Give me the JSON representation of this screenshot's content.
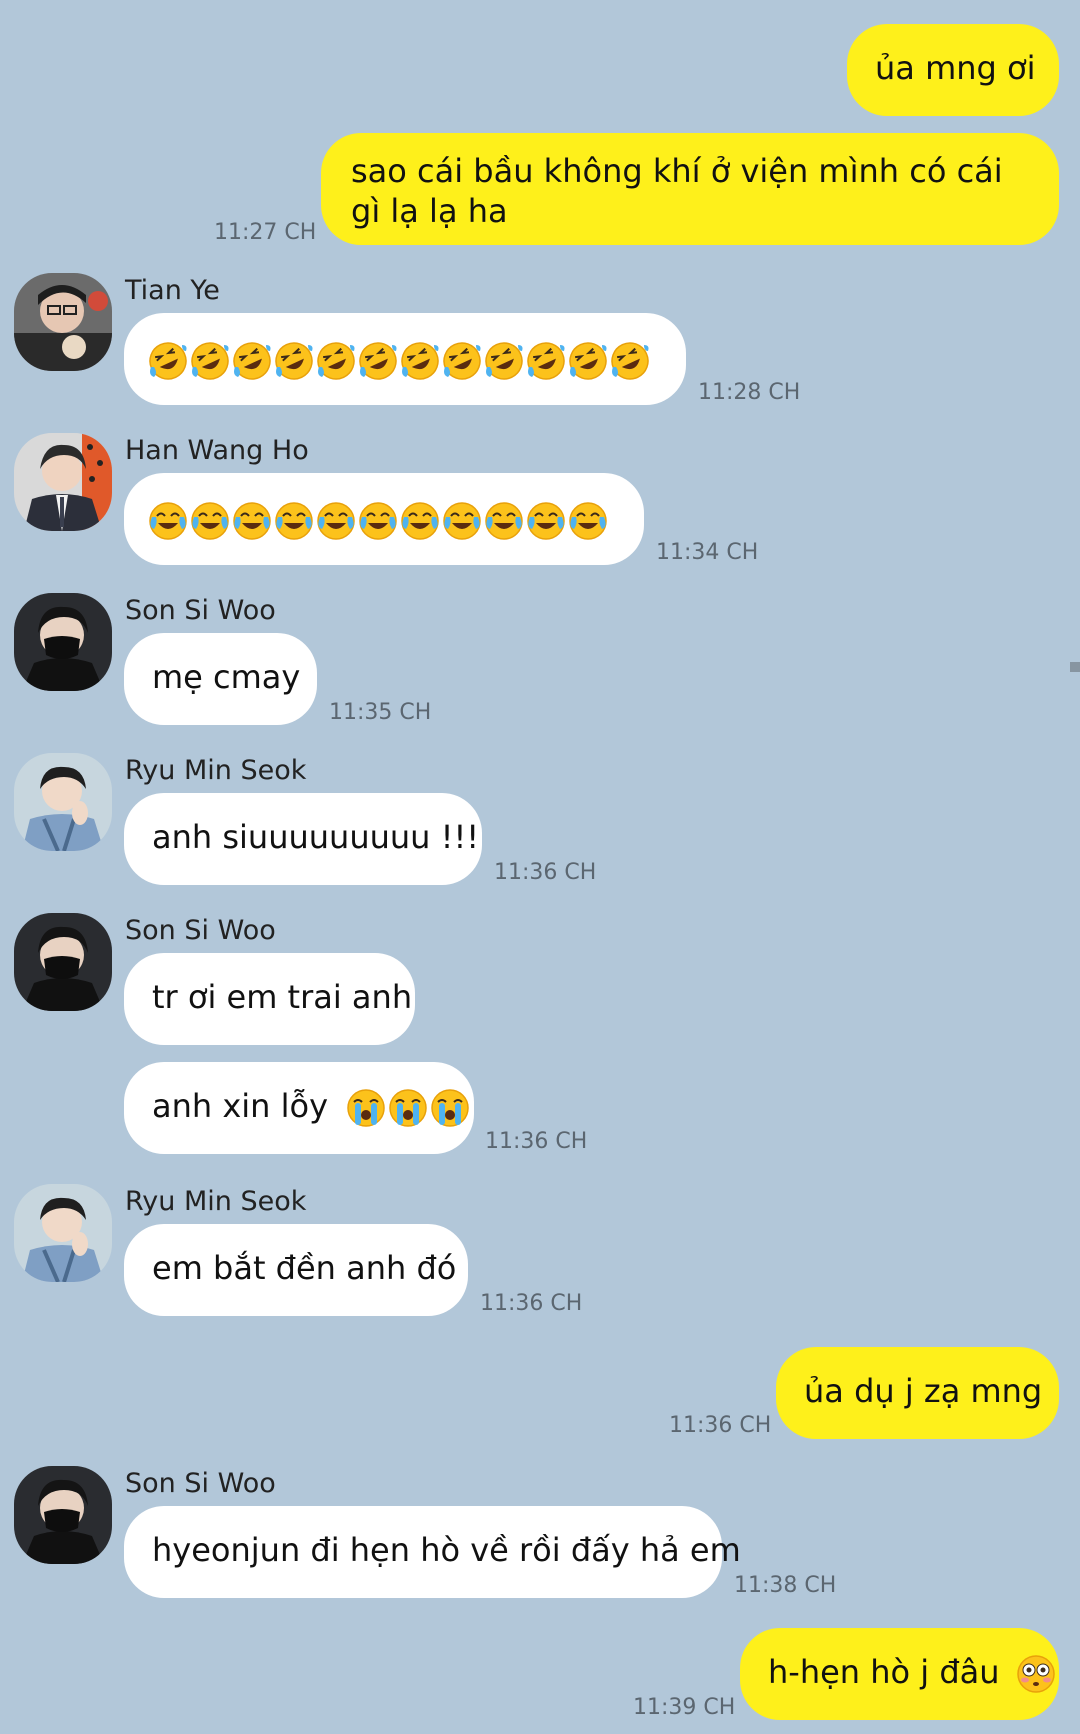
{
  "colors": {
    "background": "#b2c7d9",
    "my_bubble": "#fef01b",
    "their_bubble": "#ffffff",
    "time_text": "#5b6670"
  },
  "messages": [
    {
      "sender": "me",
      "text": "ủa mng ơi"
    },
    {
      "sender": "me",
      "text": "sao cái bầu không khí ở viện mình có cái gì lạ lạ ha",
      "time": "11:27 CH"
    },
    {
      "sender": "Tian Ye",
      "name": "Tian Ye",
      "emoji": "rofl",
      "count": 12,
      "time": "11:28 CH"
    },
    {
      "sender": "Han Wang Ho",
      "name": "Han Wang Ho",
      "emoji": "joy",
      "count": 11,
      "time": "11:34 CH"
    },
    {
      "sender": "Son Si Woo",
      "name": "Son Si Woo",
      "text": "mẹ cmay",
      "time": "11:35 CH"
    },
    {
      "sender": "Ryu Min Seok",
      "name": "Ryu Min Seok",
      "text": "anh siuuuuuuuuu !!!",
      "time": "11:36 CH"
    },
    {
      "sender": "Son Si Woo",
      "name": "Son Si Woo",
      "text": "tr ơi em trai anh"
    },
    {
      "sender": "Son Si Woo",
      "text": "anh xin lỗy",
      "trailing_emoji": "sob",
      "trailing_count": 3,
      "time": "11:36 CH"
    },
    {
      "sender": "Ryu Min Seok",
      "name": "Ryu Min Seok",
      "text": "em bắt đền anh đó",
      "time": "11:36 CH"
    },
    {
      "sender": "me",
      "text": "ủa dụ j zạ mng",
      "time": "11:36 CH"
    },
    {
      "sender": "Son Si Woo",
      "name": "Son Si Woo",
      "text": "hyeonjun đi hẹn hò về rồi đấy hả em",
      "time": "11:38 CH"
    },
    {
      "sender": "me",
      "text": "h-hẹn hò j đâu",
      "trailing_emoji": "flushed",
      "trailing_count": 1,
      "time": "11:39 CH"
    }
  ]
}
